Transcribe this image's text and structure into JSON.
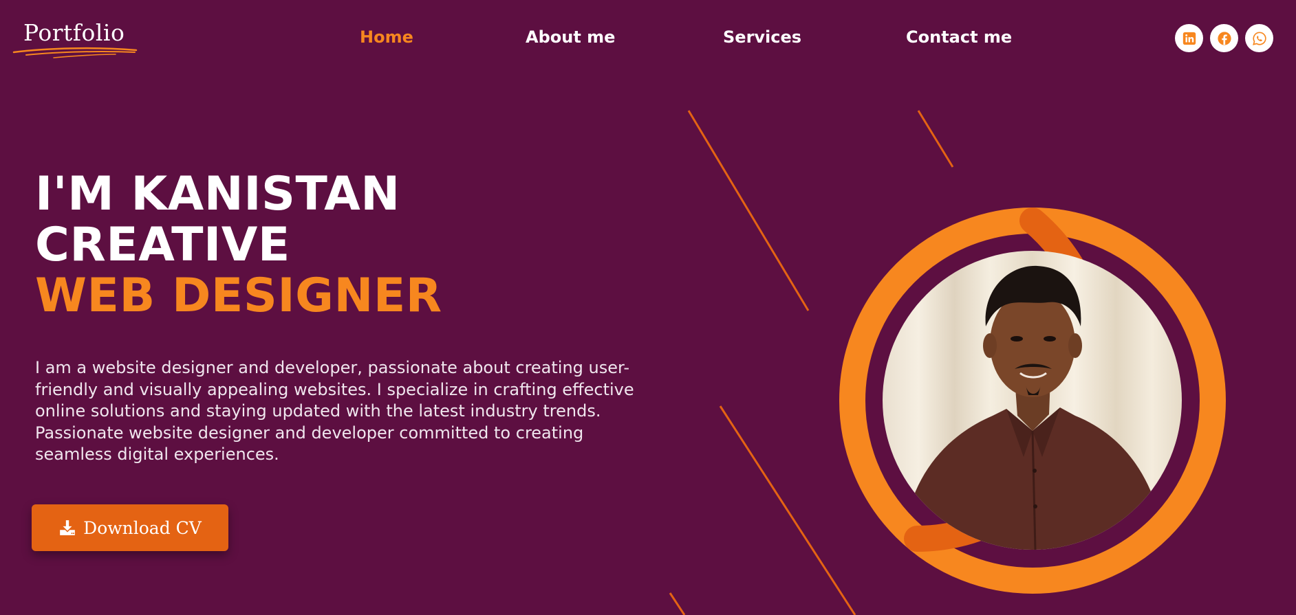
{
  "logo": {
    "text": "Portfolio"
  },
  "nav": {
    "items": [
      {
        "label": "Home",
        "active": true
      },
      {
        "label": "About me",
        "active": false
      },
      {
        "label": "Services",
        "active": false
      },
      {
        "label": "Contact me",
        "active": false
      }
    ]
  },
  "social": {
    "icons": [
      "linkedin-icon",
      "facebook-icon",
      "whatsapp-icon"
    ]
  },
  "hero": {
    "title_line1": "I'M KANISTAN",
    "title_line2": "CREATIVE",
    "title_line3": "WEB DESIGNER",
    "description": "I am a website designer and developer, passionate about creating user-friendly and visually appealing websites. I specialize in crafting effective online solutions and staying updated with the latest industry trends. Passionate website designer and developer committed to creating seamless digital experiences.",
    "cv_button_label": "Download CV",
    "cv_button_icon": "download-icon"
  },
  "profile": {
    "photo_icon": "profile-photo"
  },
  "colors": {
    "background": "#5d0f41",
    "accent": "#f7871f",
    "accent_dark": "#e46313",
    "text": "#ffffff"
  }
}
